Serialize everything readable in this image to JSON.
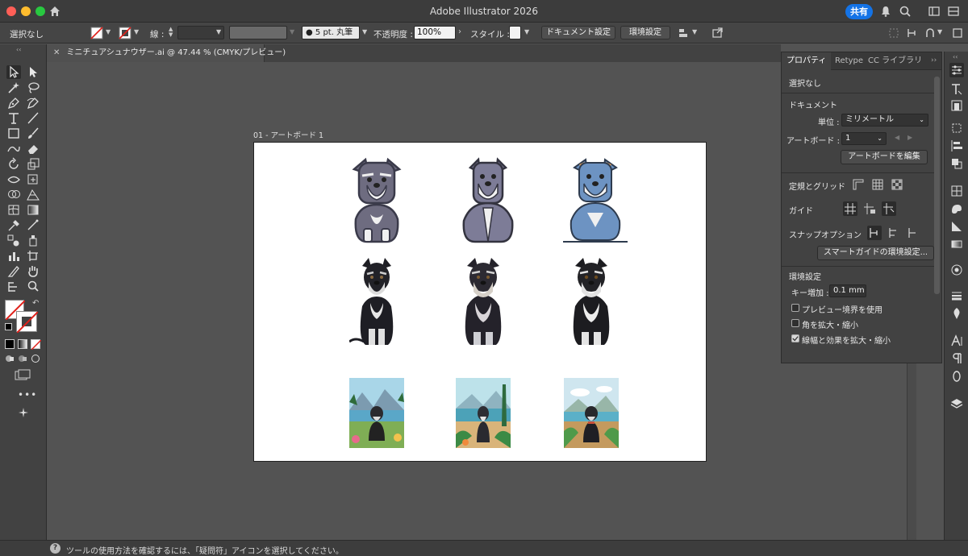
{
  "window": {
    "app_title": "Adobe Illustrator 2026",
    "share_label": "共有"
  },
  "controlbar": {
    "selection_label": "選択なし",
    "stroke_label": "線 :",
    "brush_label": "5 pt. 丸筆",
    "opacity_label": "不透明度 :",
    "opacity_value": "100%",
    "style_label": "スタイル :",
    "document_settings_label": "ドキュメント設定",
    "preferences_label": "環境設定"
  },
  "document": {
    "tab_label": "ミニチュアシュナウザー.ai @ 47.44 % (CMYK/プレビュー)",
    "artboard_label": "01 - アートボード 1"
  },
  "properties_panel": {
    "tabs": [
      "プロパティ",
      "Retype",
      "CC ライブラリ"
    ],
    "selection_status": "選択なし",
    "document_heading": "ドキュメント",
    "units_label": "単位 :",
    "units_value": "ミリメートル",
    "artboard_label": "アートボード :",
    "artboard_value": "1",
    "edit_artboard_button": "アートボードを編集",
    "rulers_grid_label": "定規とグリッド",
    "guides_label": "ガイド",
    "snap_options_label": "スナップオプション",
    "smart_guides_button": "スマートガイドの環境設定...",
    "preferences_heading": "環境設定",
    "keyboard_increment_label": "キー増加 :",
    "keyboard_increment_value": "0.1 mm",
    "checkboxes": [
      {
        "label": "プレビュー境界を使用",
        "checked": false
      },
      {
        "label": "角を拡大・縮小",
        "checked": false
      },
      {
        "label": "線幅と効果を拡大・縮小",
        "checked": true
      }
    ]
  },
  "status": {
    "help_text": "ツールの使用方法を確認するには、「疑問符」アイコンを選択してください。"
  },
  "colors": {
    "accent": "#1473e6",
    "ui_bg": "#535353",
    "panel_bg": "#424242"
  }
}
